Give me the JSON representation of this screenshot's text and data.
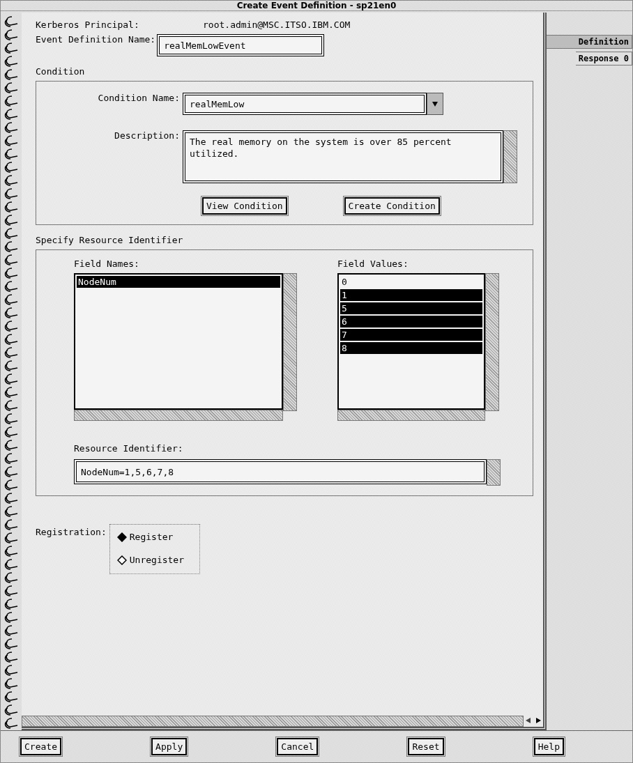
{
  "window": {
    "title": "Create Event Definition - sp21en0"
  },
  "tabs": [
    {
      "label": "Definition",
      "selected": true
    },
    {
      "label": "Response 0",
      "selected": false
    }
  ],
  "principal": {
    "label": "Kerberos Principal:",
    "value": "root.admin@MSC.ITSO.IBM.COM"
  },
  "event_name": {
    "label": "Event Definition Name:",
    "value": "realMemLowEvent"
  },
  "condition": {
    "title": "Condition",
    "name_label": "Condition Name:",
    "name_value": "realMemLow",
    "description_label": "Description:",
    "description_value": "The real memory on the system is over 85 percent utilized.",
    "buttons": [
      "View Condition",
      "Create Condition"
    ]
  },
  "resource": {
    "title": "Specify Resource Identifier",
    "field_names_label": "Field Names:",
    "field_names": [
      {
        "label": "NodeNum",
        "selected": true
      }
    ],
    "field_values_label": "Field Values:",
    "field_values": [
      {
        "label": "0",
        "selected": false
      },
      {
        "label": "1",
        "selected": true
      },
      {
        "label": "5",
        "selected": true
      },
      {
        "label": "6",
        "selected": true
      },
      {
        "label": "7",
        "selected": true
      },
      {
        "label": "8",
        "selected": true
      }
    ],
    "identifier_label": "Resource Identifier:",
    "identifier_value": "NodeNum=1,5,6,7,8"
  },
  "registration": {
    "label": "Registration:",
    "options": [
      {
        "label": "Register",
        "selected": true
      },
      {
        "label": "Unregister",
        "selected": false
      }
    ]
  },
  "buttons": [
    "Create",
    "Apply",
    "Cancel",
    "Reset",
    "Help"
  ]
}
